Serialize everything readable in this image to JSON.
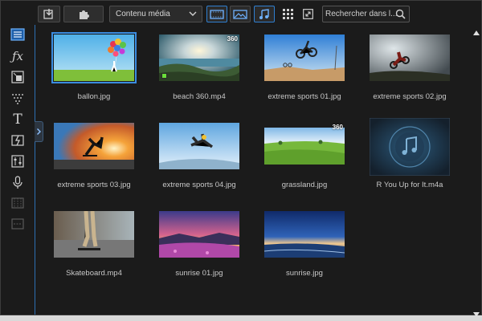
{
  "toolbar": {
    "import_icon": "import-media-icon",
    "plugins_icon": "plugins-puzzle-icon",
    "content_filter": "Contenu média",
    "view_filters": [
      {
        "name": "video-filter-icon",
        "active": true
      },
      {
        "name": "image-filter-icon",
        "active": false
      },
      {
        "name": "audio-filter-icon",
        "active": true
      }
    ],
    "grid_view_icon": "grid-view-icon",
    "expand_icon": "expand-icon",
    "search_placeholder": "Rechercher dans l..."
  },
  "rail": {
    "items": [
      {
        "name": "media-room-icon",
        "active": true
      },
      {
        "name": "fx-room-icon",
        "active": false
      },
      {
        "name": "pip-room-icon",
        "active": false
      },
      {
        "name": "particle-room-icon",
        "active": false
      },
      {
        "name": "title-room-icon",
        "active": false
      },
      {
        "name": "transition-room-icon",
        "active": false
      },
      {
        "name": "audio-mixing-room-icon",
        "active": false
      },
      {
        "name": "voice-over-icon",
        "active": false
      },
      {
        "name": "chapter-room-icon",
        "active": false
      },
      {
        "name": "subtitle-room-icon",
        "active": false
      }
    ]
  },
  "media": [
    {
      "label": "ballon.jpg",
      "thumb": "balloon",
      "selected": true,
      "is360": false
    },
    {
      "label": "beach 360.mp4",
      "thumb": "beach",
      "selected": false,
      "is360": true,
      "badge": "360"
    },
    {
      "label": "extreme sports 01.jpg",
      "thumb": "bmx",
      "selected": false,
      "is360": false
    },
    {
      "label": "extreme sports 02.jpg",
      "thumb": "moto",
      "selected": false,
      "is360": false
    },
    {
      "label": "extreme sports 03.jpg",
      "thumb": "sunsetjump",
      "selected": false,
      "is360": false
    },
    {
      "label": "extreme sports 04.jpg",
      "thumb": "skydive",
      "selected": false,
      "is360": false
    },
    {
      "label": "grassland.jpg",
      "thumb": "grass",
      "selected": false,
      "is360": true,
      "badge": "360"
    },
    {
      "label": "R You Up for It.m4a",
      "thumb": "audio",
      "selected": false,
      "is360": false
    },
    {
      "label": "Skateboard.mp4",
      "thumb": "skate",
      "selected": false,
      "is360": false
    },
    {
      "label": "sunrise 01.jpg",
      "thumb": "sunrise1",
      "selected": false,
      "is360": false
    },
    {
      "label": "sunrise.jpg",
      "thumb": "sunrise2",
      "selected": false,
      "is360": false
    }
  ],
  "colors": {
    "accent": "#2f7fd0",
    "background": "#1b1b1b",
    "caption": "#c8c8c8"
  }
}
